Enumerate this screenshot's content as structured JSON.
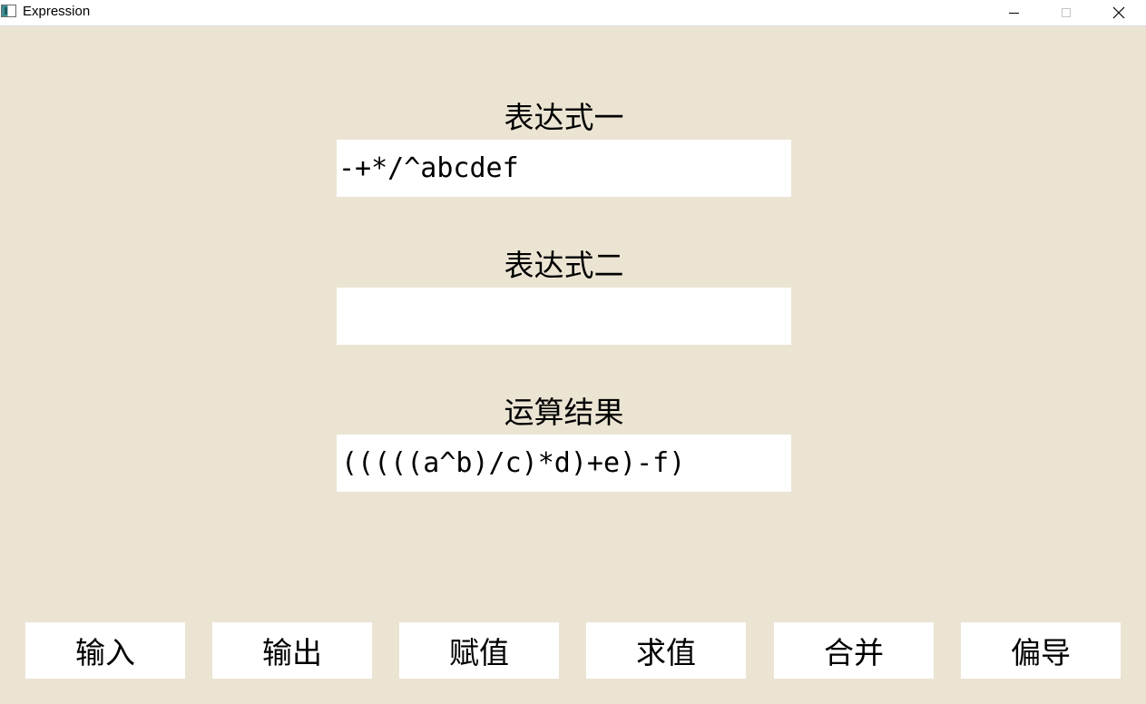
{
  "window": {
    "title": "Expression",
    "icons": {
      "app": "app-icon",
      "minimize": "minimize-icon",
      "maximize": "maximize-icon",
      "close": "close-icon"
    }
  },
  "expression1": {
    "label": "表达式一",
    "value": "-+*/^abcdef"
  },
  "expression2": {
    "label": "表达式二",
    "value": ""
  },
  "result": {
    "label": "运算结果",
    "value": "(((((a^b)/c)*d)+e)-f)"
  },
  "buttons": [
    {
      "label": "输入"
    },
    {
      "label": "输出"
    },
    {
      "label": "赋值"
    },
    {
      "label": "求值"
    },
    {
      "label": "合并"
    },
    {
      "label": "偏导"
    }
  ],
  "colors": {
    "background": "#ebe4d3",
    "field": "#ffffff",
    "text": "#000000"
  }
}
